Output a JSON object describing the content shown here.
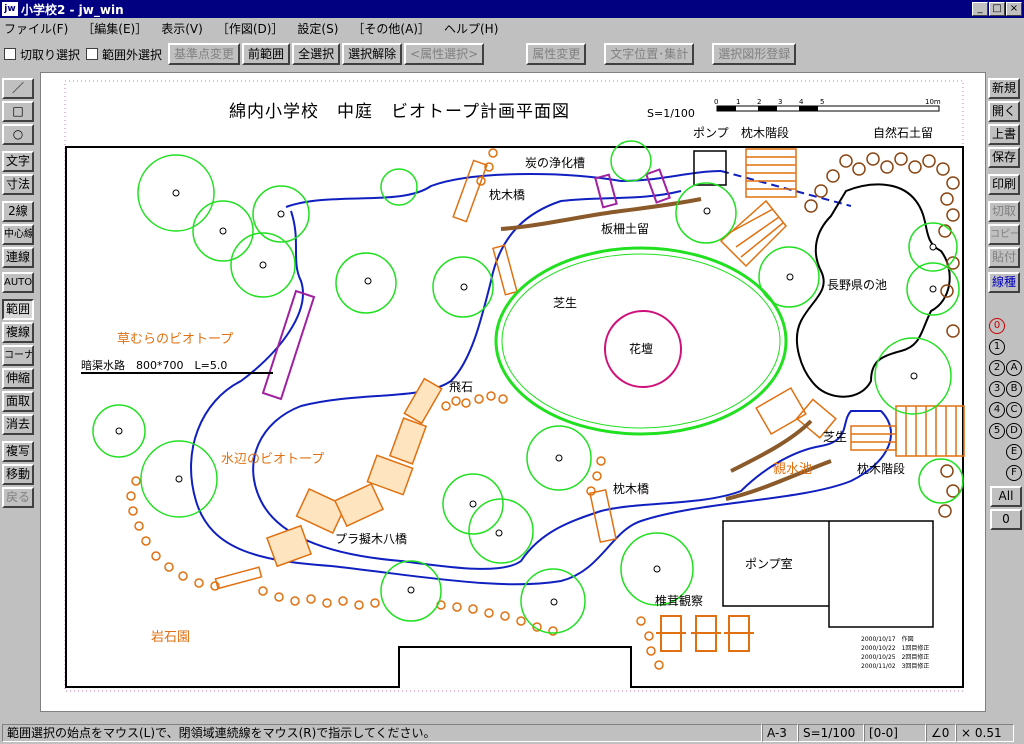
{
  "window": {
    "icon": "jw",
    "title": "小学校2 - jw_win"
  },
  "menu": [
    "ファイル(F)",
    "［編集(E)］",
    "表示(V)",
    "［作図(D)］",
    "設定(S)",
    "［その他(A)］",
    "ヘルプ(H)"
  ],
  "toolbar": {
    "checks": [
      "切取り選択",
      "範囲外選択"
    ],
    "buttons": [
      "基準点変更",
      "前範囲",
      "全選択",
      "選択解除",
      "<属性選択>",
      "属性変更",
      "文字位置･集計",
      "選択図形登録"
    ]
  },
  "left_tools": [
    "／",
    "□",
    "○",
    "文字",
    "寸法",
    "2線",
    "中心線",
    "連線",
    "AUTO",
    "範囲",
    "複線",
    "コーナー",
    "伸縮",
    "面取",
    "消去",
    "複写",
    "移動",
    "戻る"
  ],
  "right_tools": [
    "新規",
    "開く",
    "上書",
    "保存",
    "印刷",
    "切取",
    "コピー",
    "貼付",
    "線種"
  ],
  "layers": [
    "0",
    "1",
    "2",
    "3",
    "4",
    "5",
    "A",
    "B",
    "C",
    "D",
    "E",
    "F"
  ],
  "layer_bottom": [
    "All",
    "0"
  ],
  "drawing": {
    "title": "綿内小学校　中庭　ビオトープ計画平面図",
    "scale_label": "S=1/100",
    "scale_ticks": [
      "0",
      "1",
      "2",
      "3",
      "4",
      "5",
      "10m"
    ],
    "labels": {
      "pump": "ポンプ",
      "step_top": "枕木階段",
      "stone": "自然石土留",
      "charcoal": "炭の浄化槽",
      "bridge1": "枕木橋",
      "fence": "板柵土留",
      "lawn1": "芝生",
      "flowerbed": "花壇",
      "pond": "長野県の池",
      "grass_biotope": "草むらのビオトープ",
      "culvert": "暗渠水路　800*700　L=5.0",
      "stepstone": "飛石",
      "water_biotope": "水辺のビオトープ",
      "lawn2": "芝生",
      "shinsui": "親水池",
      "step_right": "枕木階段",
      "bridge2": "枕木橋",
      "yatsuhashi": "プラ擬木八橋",
      "pumproom": "ポンプ室",
      "mushroom": "椎茸観察",
      "rock": "岩石園"
    },
    "revisions": [
      "2000/10/17　作図",
      "2000/10/22　1回目修正",
      "2000/10/25　2回目修正",
      "2000/11/02　3回目修正"
    ]
  },
  "status": {
    "message": "範囲選択の始点をマウス(L)で、閉領域連続線をマウス(R)で指示してください。",
    "layer": "A-3",
    "scale": "S=1/100",
    "group": "[0-0]",
    "angle": "∠0",
    "zoom": "× 0.51"
  }
}
